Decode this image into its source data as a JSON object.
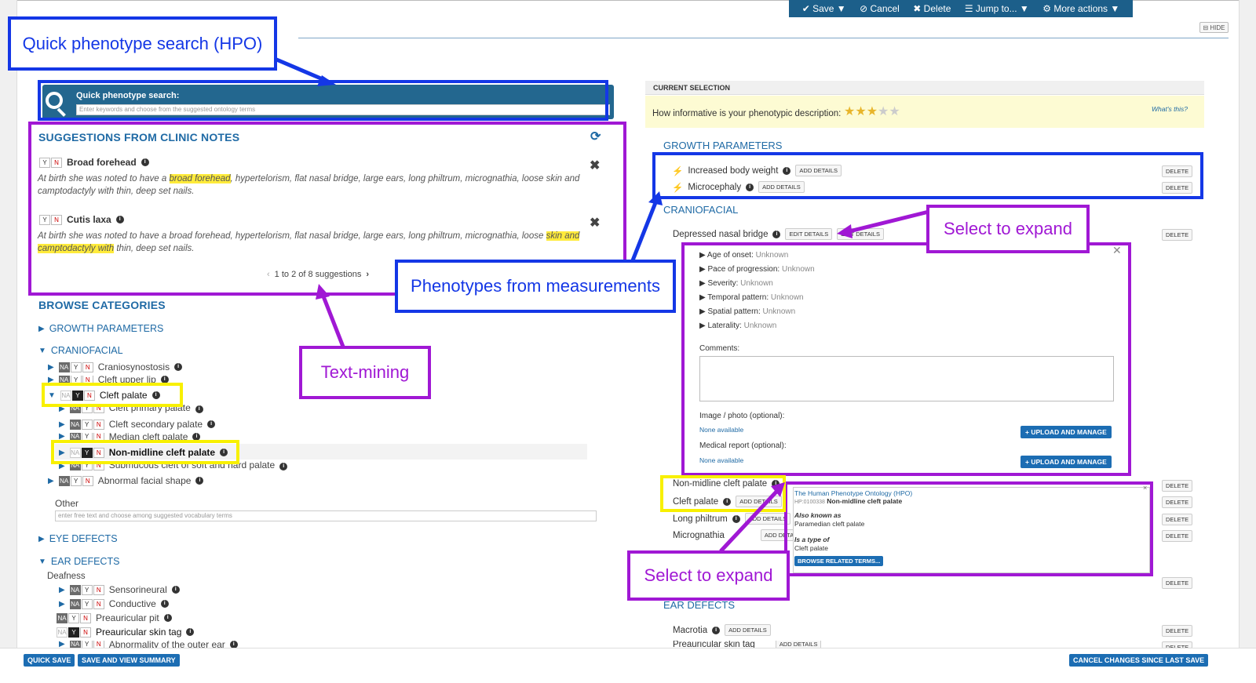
{
  "toolbar": {
    "save": "✔ Save ▼",
    "cancel": "⊘ Cancel",
    "delete": "✖ Delete",
    "jump": "☰ Jump to... ▼",
    "more": "⚙ More actions ▼"
  },
  "hide_label": "⊟ HIDE",
  "quick_search": {
    "label": "Quick phenotype search:",
    "placeholder": "Enter keywords and choose from the suggested ontology terms"
  },
  "suggestions": {
    "title": "SUGGESTIONS FROM CLINIC NOTES",
    "items": [
      {
        "name": "Broad forehead",
        "pre": "At birth she was noted to have a ",
        "highlight": "broad forehead",
        "post": ", hypertelorism, flat nasal bridge, large ears, long philtrum, micrognathia, loose skin and camptodactyly with thin, deep set nails."
      },
      {
        "name": "Cutis laxa",
        "pre": "At birth she was noted to have a broad forehead, hypertelorism, flat nasal bridge, large ears, long philtrum, micrognathia, loose ",
        "highlight": "skin and camptodactyly with",
        "post": " thin, deep set nails."
      }
    ],
    "pagination": "1 to 2 of 8 suggestions"
  },
  "browse": {
    "title": "BROWSE CATEGORIES",
    "growth": "GROWTH PARAMETERS",
    "craniofacial": "CRANIOFACIAL",
    "cranio_items": [
      "Craniosynostosis",
      "Cleft upper lip",
      "Cleft palate",
      "Cleft primary palate",
      "Cleft secondary palate",
      "Median cleft palate",
      "Non-midline cleft palate",
      "Submucous cleft of soft and hard palate",
      "Abnormal facial shape"
    ],
    "other_label": "Other",
    "other_placeholder": "enter free text and choose among suggested vocabulary terms",
    "eye": "EYE DEFECTS",
    "ear": "EAR DEFECTS",
    "deafness": "Deafness",
    "ear_items": [
      "Sensorineural",
      "Conductive",
      "Preauricular pit",
      "Preauricular skin tag",
      "Abnormality of the outer ear"
    ]
  },
  "yn": {
    "na": "NA",
    "y": "Y",
    "n": "N"
  },
  "current": {
    "header": "CURRENT SELECTION",
    "informative": "How informative is your phenotypic description:",
    "rating": 3,
    "rating_max": 5,
    "whats_this": "What's this?",
    "growth_title": "GROWTH PARAMETERS",
    "growth_items": [
      "Increased body weight",
      "Microcephaly"
    ],
    "cranio_title": "CRANIOFACIAL",
    "depressed": "Depressed nasal bridge",
    "edit_details": "EDIT DETAILS",
    "add_details": "ADD DETAILS",
    "delete": "DELETE",
    "detail_fields": [
      {
        "label": "Age of onset:",
        "value": "Unknown"
      },
      {
        "label": "Pace of progression:",
        "value": "Unknown"
      },
      {
        "label": "Severity:",
        "value": "Unknown"
      },
      {
        "label": "Temporal pattern:",
        "value": "Unknown"
      },
      {
        "label": "Spatial pattern:",
        "value": "Unknown"
      },
      {
        "label": "Laterality:",
        "value": "Unknown"
      }
    ],
    "comments": "Comments:",
    "image_label": "Image / photo (optional):",
    "none_available": "None available",
    "upload": "+ UPLOAD AND MANAGE",
    "medical_label": "Medical report (optional):",
    "cranio_items": [
      "Non-midline cleft palate",
      "Cleft palate",
      "Long philtrum",
      "Micrognathia"
    ],
    "ear_title": "EAR DEFECTS",
    "ear_items": [
      "Macrotia",
      "Preauricular skin tag"
    ]
  },
  "hpo_popup": {
    "source": "The Human Phenotype Ontology (HPO)",
    "id": "HP:0100338",
    "name": "Non-midline cleft palate",
    "aka_label": "Also known as",
    "aka": "Paramedian cleft palate",
    "type_label": "Is a type of",
    "type": "Cleft palate",
    "browse": "BROWSE RELATED TERMS..."
  },
  "bottom": {
    "quick_save": "QUICK SAVE",
    "save_view": "SAVE AND VIEW SUMMARY",
    "cancel_changes": "CANCEL CHANGES SINCE LAST SAVE"
  },
  "annotations": {
    "quick_search": "Quick phenotype search (HPO)",
    "measurements": "Phenotypes from measurements",
    "text_mining": "Text-mining",
    "select_expand_1": "Select to expand",
    "select_expand_2": "Select to expand"
  },
  "colors": {
    "annotation_blue": "#1437e6",
    "annotation_purple": "#a018d4",
    "annotation_yellow": "#f8f000",
    "toolbar": "#1c5f8a",
    "link": "#1f6aa5"
  }
}
